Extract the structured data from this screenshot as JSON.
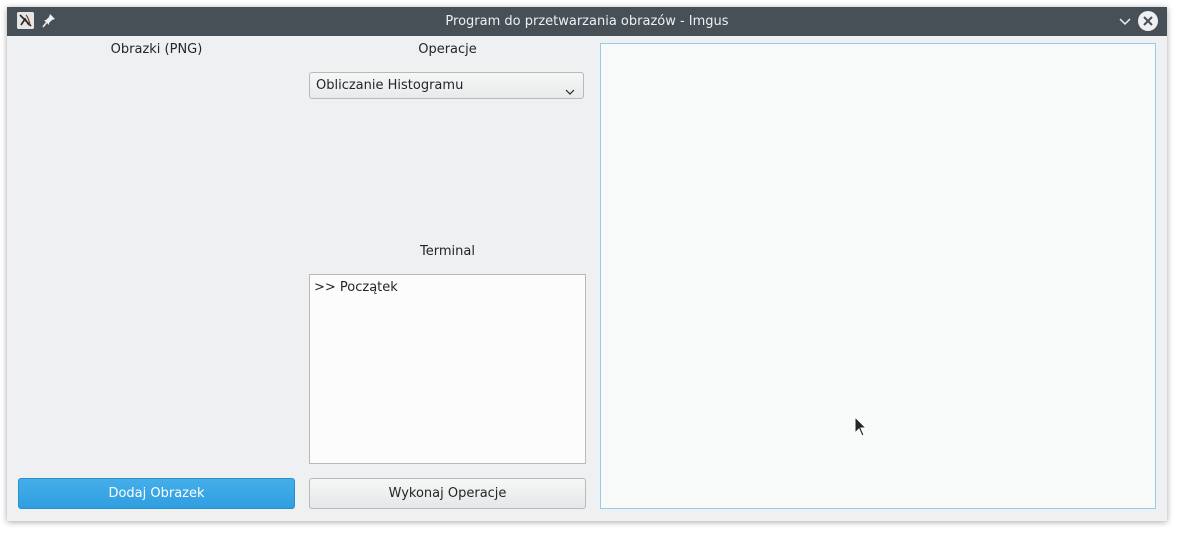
{
  "window": {
    "title": "Program do przetwarzania obrazów - Imgus"
  },
  "left_panel": {
    "heading": "Obrazki (PNG)",
    "add_button_label": "Dodaj Obrazek"
  },
  "middle_panel": {
    "operations_heading": "Operacje",
    "operation_selected": "Obliczanie Histogramu",
    "terminal_heading": "Terminal",
    "terminal_lines": [
      ">> Początek"
    ],
    "execute_button_label": "Wykonaj Operacje"
  },
  "colors": {
    "accent": "#3daee9",
    "titlebar": "#475057",
    "window_bg": "#eff0f1"
  },
  "icons": [
    "app-icon",
    "pin-icon",
    "minimize-icon",
    "close-icon",
    "chevron-down-icon",
    "mouse-cursor-icon"
  ]
}
